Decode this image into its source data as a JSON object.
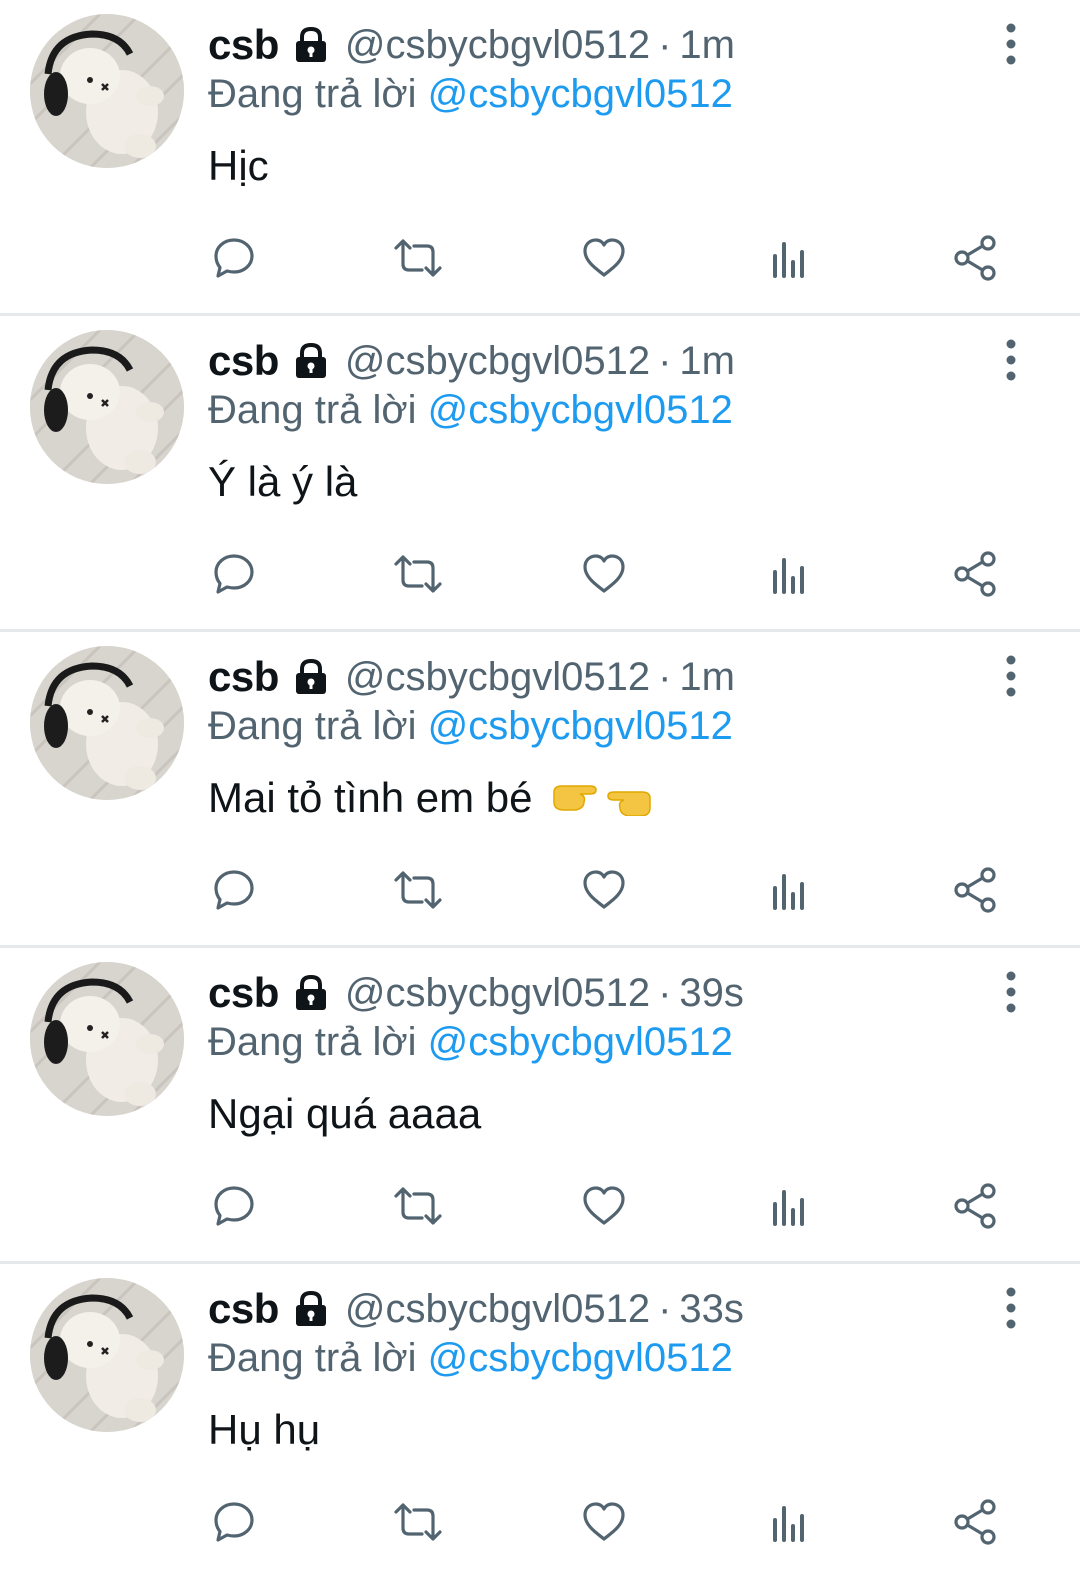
{
  "colors": {
    "text": "#0f1419",
    "secondary": "#536471",
    "link": "#1d9bf0",
    "divider": "#e6e9eb"
  },
  "icons": {
    "lock": "lock-icon",
    "more": "more-vertical-icon",
    "reply": "reply-icon",
    "retweet": "retweet-icon",
    "like": "heart-icon",
    "views": "views-icon",
    "share": "share-icon"
  },
  "tweets": [
    {
      "name": "csb",
      "handle": "@csbycbgvl0512",
      "separator": "·",
      "time": "1m",
      "reply_prefix": "Đang trả lời",
      "reply_to": "@csbycbgvl0512",
      "text": "Hịc"
    },
    {
      "name": "csb",
      "handle": "@csbycbgvl0512",
      "separator": "·",
      "time": "1m",
      "reply_prefix": "Đang trả lời",
      "reply_to": "@csbycbgvl0512",
      "text": "Ý là ý là"
    },
    {
      "name": "csb",
      "handle": "@csbycbgvl0512",
      "separator": "·",
      "time": "1m",
      "reply_prefix": "Đang trả lời",
      "reply_to": "@csbycbgvl0512",
      "text": "Mai tỏ tình em bé",
      "emoji": "👉👈"
    },
    {
      "name": "csb",
      "handle": "@csbycbgvl0512",
      "separator": "·",
      "time": "39s",
      "reply_prefix": "Đang trả lời",
      "reply_to": "@csbycbgvl0512",
      "text": "Ngại quá aaaa"
    },
    {
      "name": "csb",
      "handle": "@csbycbgvl0512",
      "separator": "·",
      "time": "33s",
      "reply_prefix": "Đang trả lời",
      "reply_to": "@csbycbgvl0512",
      "text": "Hụ hụ"
    }
  ]
}
